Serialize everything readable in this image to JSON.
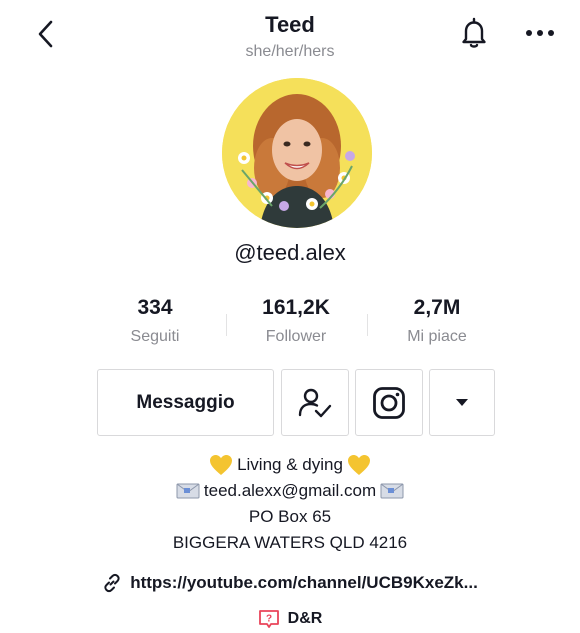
{
  "header": {
    "title": "Teed",
    "pronouns": "she/her/hers"
  },
  "profile": {
    "username": "@teed.alex"
  },
  "stats": [
    {
      "value": "334",
      "label": "Seguiti"
    },
    {
      "value": "161,2K",
      "label": "Follower"
    },
    {
      "value": "2,7M",
      "label": "Mi piace"
    }
  ],
  "actions": {
    "message_label": "Messaggio"
  },
  "bio": {
    "line1": "Living & dying",
    "line2": "teed.alexx@gmail.com",
    "line3": "PO Box 65",
    "line4": "BIGGERA WATERS QLD 4216"
  },
  "link": {
    "url_text": "https://youtube.com/channel/UCB9KxeZk..."
  },
  "qna": {
    "label": "D&R"
  },
  "colors": {
    "text": "#161823",
    "secondary": "#8a8b91",
    "border": "#d9d9db",
    "avatar_bg": "#f5e05a",
    "heart": "#f4c430",
    "qna_icon": "#e9445a"
  },
  "icons": [
    "back-chevron-icon",
    "bell-icon",
    "more-horizontal-icon",
    "user-check-icon",
    "instagram-icon",
    "caret-down-icon",
    "yellow-heart-icon",
    "envelope-icon",
    "link-icon",
    "question-box-icon"
  ]
}
